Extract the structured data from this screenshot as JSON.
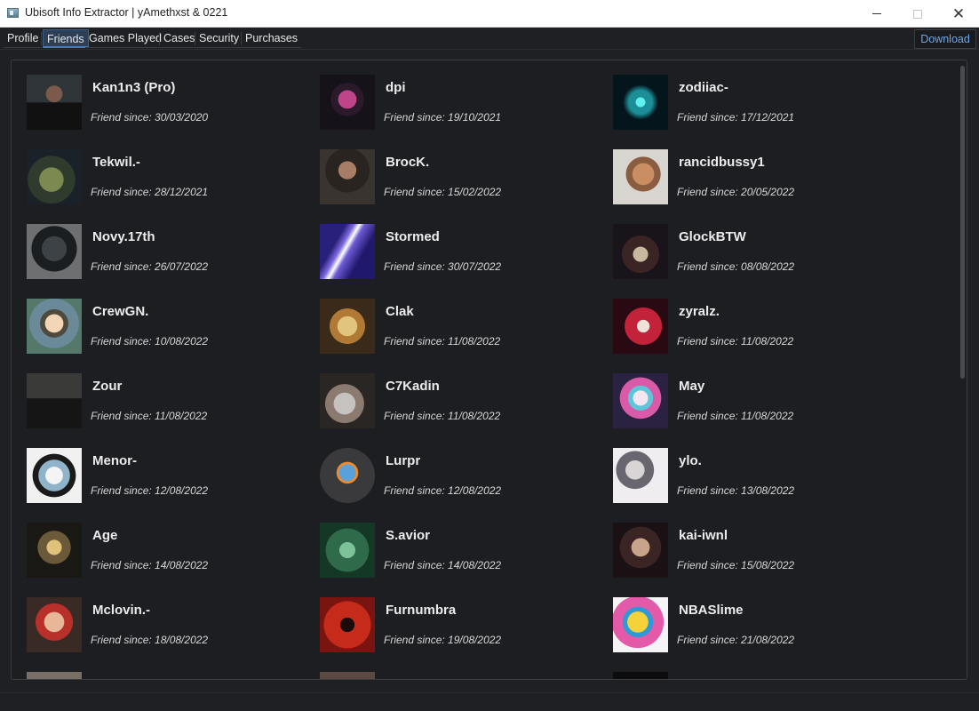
{
  "window": {
    "title": "Ubisoft Info Extractor | yAmethxst & 0221",
    "minimize_glyph": "",
    "maximize_glyph": "",
    "close_glyph": "✕"
  },
  "tabs": [
    {
      "label": "Profile",
      "active": false
    },
    {
      "label": "Friends",
      "active": true
    },
    {
      "label": "Games Played",
      "active": false
    },
    {
      "label": "Cases",
      "active": false
    },
    {
      "label": "Security",
      "active": false
    },
    {
      "label": "Purchases",
      "active": false
    }
  ],
  "download_label": "Download",
  "friends": [
    {
      "name": "Kan1n3 (Pro)",
      "since": "Friend since: 30/03/2020"
    },
    {
      "name": "dpi",
      "since": "Friend since: 19/10/2021"
    },
    {
      "name": "zodiiac-",
      "since": "Friend since: 17/12/2021"
    },
    {
      "name": "Tekwil.-",
      "since": "Friend since: 28/12/2021"
    },
    {
      "name": "BrocK.",
      "since": "Friend since: 15/02/2022"
    },
    {
      "name": "rancidbussy1",
      "since": "Friend since: 20/05/2022"
    },
    {
      "name": "Novy.17th",
      "since": "Friend since: 26/07/2022"
    },
    {
      "name": "Stormed",
      "since": "Friend since: 30/07/2022"
    },
    {
      "name": "GlockBTW",
      "since": "Friend since: 08/08/2022"
    },
    {
      "name": "CrewGN.",
      "since": "Friend since: 10/08/2022"
    },
    {
      "name": "Clak",
      "since": "Friend since: 11/08/2022"
    },
    {
      "name": "zyralz.",
      "since": "Friend since: 11/08/2022"
    },
    {
      "name": "Zour",
      "since": "Friend since: 11/08/2022"
    },
    {
      "name": "C7Kadin",
      "since": "Friend since: 11/08/2022"
    },
    {
      "name": "May",
      "since": "Friend since: 11/08/2022"
    },
    {
      "name": "Menor-",
      "since": "Friend since: 12/08/2022"
    },
    {
      "name": "Lurpr",
      "since": "Friend since: 12/08/2022"
    },
    {
      "name": "ylo.",
      "since": "Friend since: 13/08/2022"
    },
    {
      "name": "Age",
      "since": "Friend since: 14/08/2022"
    },
    {
      "name": "S.avior",
      "since": "Friend since: 14/08/2022"
    },
    {
      "name": "kai-iwnl",
      "since": "Friend since: 15/08/2022"
    },
    {
      "name": "Mclovin.-",
      "since": "Friend since: 18/08/2022"
    },
    {
      "name": "Furnumbra",
      "since": "Friend since: 19/08/2022"
    },
    {
      "name": "NBASlime",
      "since": "Friend since: 21/08/2022"
    }
  ],
  "colors": {
    "background": "#1f2023",
    "panel": "#1d1e21",
    "active_tab": "#2c3f56",
    "download_text": "#6da8e8"
  }
}
